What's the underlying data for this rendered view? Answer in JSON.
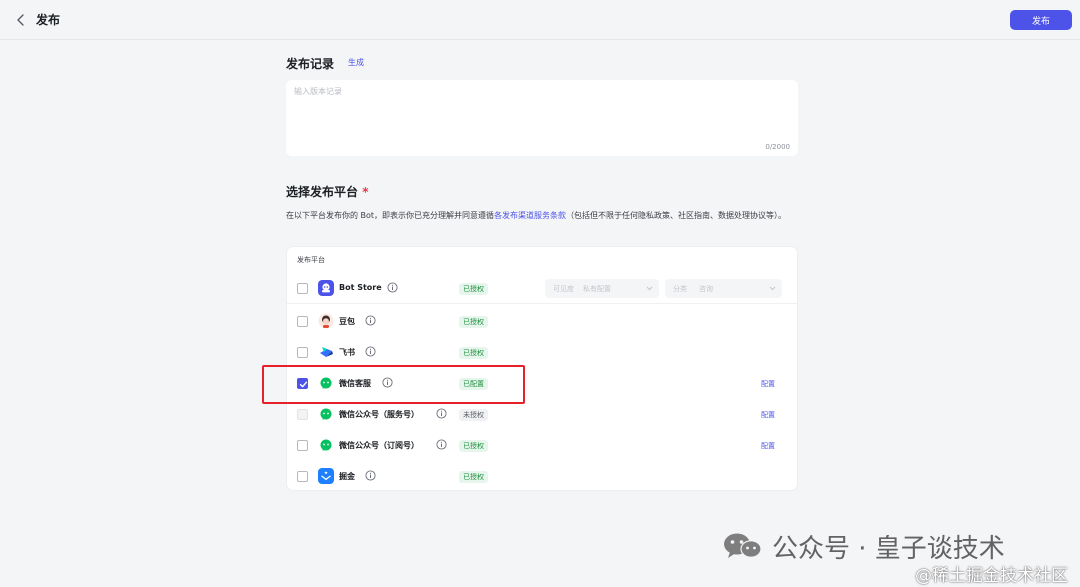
{
  "header": {
    "title": "发布",
    "publish_label": "发布"
  },
  "record": {
    "title": "发布记录",
    "generate_label": "生成",
    "placeholder": "输入版本记录",
    "char_count": "0/2000"
  },
  "platforms_section": {
    "title": "选择发布平台",
    "required_mark": "*",
    "desc_prefix": "在以下平台发布你的 Bot，即表示你已充分理解并同意遵循",
    "terms_link": "各发布渠道服务条款",
    "desc_suffix": "（包括但不限于任何隐私政策、社区指南、数据处理协议等）。",
    "table_header": "发布平台"
  },
  "bot_store_selects": {
    "visibility": {
      "label": "可见度",
      "value": "私有配置"
    },
    "category": {
      "label": "分类",
      "value": "咨询"
    }
  },
  "platforms": [
    {
      "name": "Bot Store",
      "status": "已授权",
      "status_type": "ok",
      "checked": false,
      "disabled": false,
      "icon": "bot-store-icon",
      "config": ""
    },
    {
      "name": "豆包",
      "status": "已授权",
      "status_type": "ok",
      "checked": false,
      "disabled": false,
      "icon": "doubao-icon",
      "config": ""
    },
    {
      "name": "飞书",
      "status": "已授权",
      "status_type": "ok",
      "checked": false,
      "disabled": false,
      "icon": "feishu-icon",
      "config": ""
    },
    {
      "name": "微信客服",
      "status": "已配置",
      "status_type": "ok",
      "checked": true,
      "disabled": false,
      "icon": "wechat-icon",
      "config": "配置"
    },
    {
      "name": "微信公众号（服务号）",
      "status": "未授权",
      "status_type": "no",
      "checked": false,
      "disabled": true,
      "icon": "wechat-icon",
      "config": "配置"
    },
    {
      "name": "微信公众号（订阅号）",
      "status": "已授权",
      "status_type": "ok",
      "checked": false,
      "disabled": false,
      "icon": "wechat-icon",
      "config": "配置"
    },
    {
      "name": "掘金",
      "status": "已授权",
      "status_type": "ok",
      "checked": false,
      "disabled": false,
      "icon": "juejin-icon",
      "config": ""
    }
  ],
  "watermark": {
    "main": "公众号 · 皇子谈技术",
    "sub": "@稀土掘金技术社区"
  },
  "colors": {
    "accent": "#4d53e8",
    "authorized": "#1f8f3f",
    "highlight": "#e8202a"
  }
}
